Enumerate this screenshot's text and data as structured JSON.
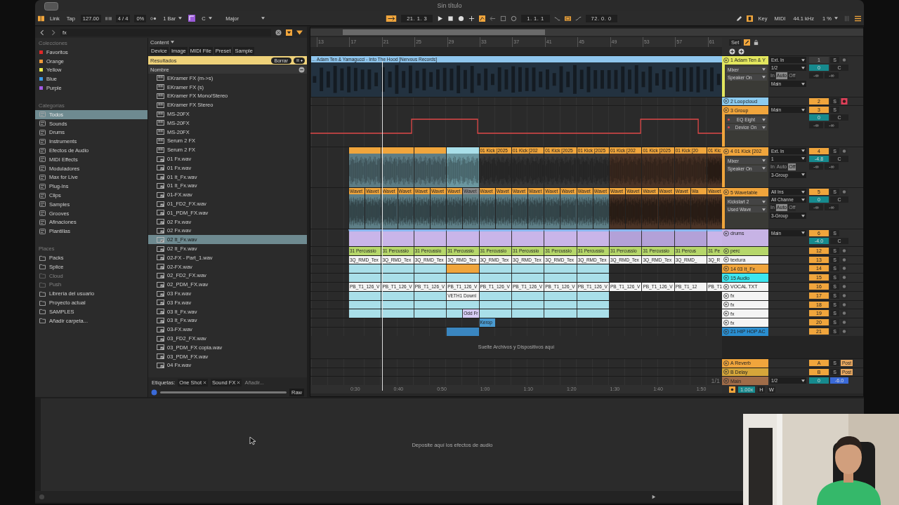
{
  "window": {
    "title": "Sin título"
  },
  "toolbar": {
    "link": "Link",
    "tap": "Tap",
    "tempo": "127.00",
    "signature": "4 / 4",
    "swing": "0%",
    "quantize": "1 Bar",
    "key": "C",
    "scale": "Major",
    "position": "21. 1. 3",
    "loop_start": "1. 1. 1",
    "loop_length": "72. 0. 0",
    "key_map": "Key",
    "midi_map": "MIDI",
    "sample_rate": "44.1 kHz",
    "cpu": "1 %"
  },
  "browser": {
    "search": "fx",
    "collections_title": "Colecciones",
    "collections": [
      {
        "label": "Favoritos",
        "color": "#e02828"
      },
      {
        "label": "Orange",
        "color": "#f09a3a"
      },
      {
        "label": "Yellow",
        "color": "#e8e84a"
      },
      {
        "label": "Blue",
        "color": "#3a9ae8"
      },
      {
        "label": "Purple",
        "color": "#a45ae8"
      }
    ],
    "categories_title": "Categorías",
    "categories": [
      {
        "label": "Todos",
        "selected": true
      },
      {
        "label": "Sounds",
        "selected": false
      },
      {
        "label": "Drums",
        "selected": false
      },
      {
        "label": "Instruments",
        "selected": false
      },
      {
        "label": "Efectos de Audio",
        "selected": false
      },
      {
        "label": "MIDI Effects",
        "selected": false
      },
      {
        "label": "Moduladores",
        "selected": false
      },
      {
        "label": "Max for Live",
        "selected": false
      },
      {
        "label": "Plug-Ins",
        "selected": false
      },
      {
        "label": "Clips",
        "selected": false
      },
      {
        "label": "Samples",
        "selected": false
      },
      {
        "label": "Grooves",
        "selected": false
      },
      {
        "label": "Afinaciones",
        "selected": false
      },
      {
        "label": "Plantillas",
        "selected": false
      }
    ],
    "places_title": "Places",
    "places": [
      {
        "label": "Packs",
        "disabled": false
      },
      {
        "label": "Splice",
        "disabled": false
      },
      {
        "label": "Cloud",
        "disabled": true
      },
      {
        "label": "Push",
        "disabled": true
      },
      {
        "label": "Librería del usuario",
        "disabled": false
      },
      {
        "label": "Proyecto actual",
        "disabled": false
      },
      {
        "label": "SAMPLES",
        "disabled": false
      },
      {
        "label": "Añadir carpeta...",
        "disabled": false
      }
    ],
    "content_filter": "Content",
    "filters": [
      "Device",
      "Image",
      "MIDI File",
      "Preset",
      "Sample"
    ],
    "results_label": "Resultados",
    "clear_button": "Borrar",
    "column": "Nombre",
    "files": [
      {
        "name": "EKramer FX (m->s)",
        "kind": "device",
        "selected": false
      },
      {
        "name": "EKramer FX (s)",
        "kind": "device",
        "selected": false
      },
      {
        "name": "EKramer FX Mono/Stereo",
        "kind": "device",
        "selected": false
      },
      {
        "name": "EKramer FX Stereo",
        "kind": "device",
        "selected": false
      },
      {
        "name": "MS-20FX",
        "kind": "device",
        "selected": false
      },
      {
        "name": "MS-20FX",
        "kind": "device",
        "selected": false
      },
      {
        "name": "MS-20FX",
        "kind": "device",
        "selected": false
      },
      {
        "name": "Serum 2 FX",
        "kind": "device",
        "selected": false
      },
      {
        "name": "Serum 2 FX",
        "kind": "device",
        "selected": false
      },
      {
        "name": "01 Fx.wav",
        "kind": "sample",
        "selected": false
      },
      {
        "name": "01 Fx.wav",
        "kind": "sample",
        "selected": false
      },
      {
        "name": "01 It_Fx.wav",
        "kind": "sample",
        "selected": false
      },
      {
        "name": "01 It_Fx.wav",
        "kind": "sample",
        "selected": false
      },
      {
        "name": "01-FX.wav",
        "kind": "sample",
        "selected": false
      },
      {
        "name": "01_FD2_FX.wav",
        "kind": "sample",
        "selected": false
      },
      {
        "name": "01_PDM_FX.wav",
        "kind": "sample",
        "selected": false
      },
      {
        "name": "02 Fx.wav",
        "kind": "sample",
        "selected": false
      },
      {
        "name": "02 Fx.wav",
        "kind": "sample",
        "selected": false
      },
      {
        "name": "02 It_Fx.wav",
        "kind": "sample",
        "selected": true
      },
      {
        "name": "02 It_Fx.wav",
        "kind": "sample",
        "selected": false
      },
      {
        "name": "02-FX - Part_1.wav",
        "kind": "sample",
        "selected": false
      },
      {
        "name": "02-FX.wav",
        "kind": "sample",
        "selected": false
      },
      {
        "name": "02_FD2_FX.wav",
        "kind": "sample",
        "selected": false
      },
      {
        "name": "02_PDM_FX.wav",
        "kind": "sample",
        "selected": false
      },
      {
        "name": "03 Fx.wav",
        "kind": "sample",
        "selected": false
      },
      {
        "name": "03 Fx.wav",
        "kind": "sample",
        "selected": false
      },
      {
        "name": "03 It_Fx.wav",
        "kind": "sample",
        "selected": false
      },
      {
        "name": "03 It_Fx.wav",
        "kind": "sample",
        "selected": false
      },
      {
        "name": "03-FX.wav",
        "kind": "sample",
        "selected": false
      },
      {
        "name": "03_FD2_FX.wav",
        "kind": "sample",
        "selected": false
      },
      {
        "name": "03_PDM_FX copia.wav",
        "kind": "sample",
        "selected": false
      },
      {
        "name": "03_PDM_FX.wav",
        "kind": "sample",
        "selected": false
      },
      {
        "name": "04 Fx.wav",
        "kind": "sample",
        "selected": false
      }
    ],
    "tags_label": "Etiquetas:",
    "tags": [
      "One Shot",
      "Sound FX"
    ],
    "tag_placeholder": "Añadir...",
    "raw_button": "Raw"
  },
  "arrangement": {
    "bars": [
      "13",
      "17",
      "21",
      "25",
      "29",
      "33",
      "37",
      "41",
      "45",
      "49",
      "53",
      "57",
      "61"
    ],
    "times": [
      "0:30",
      "0:40",
      "0:50",
      "1:00",
      "1:10",
      "1:20",
      "1:30",
      "1:40",
      "1:50"
    ],
    "set_label": "Set",
    "drop_hint": "Suelte Archivos y Dispositivos aquí",
    "zoom_ratio": "1/1",
    "tracks": [
      {
        "name": "1 Adam Ten & Y",
        "kind": "tall",
        "color": "#e2e65e",
        "devices": [
          {
            "label": "Mixer",
            "automated": false
          },
          {
            "label": "Speaker On",
            "automated": false
          }
        ],
        "inputs": [
          "Ext. In",
          "1/2"
        ],
        "monitor": [
          {
            "label": "In",
            "selected": false
          },
          {
            "label": "Auto",
            "selected": true
          },
          {
            "label": "Off",
            "selected": false
          }
        ],
        "output": "Main",
        "number": "1",
        "on": false,
        "solo": "S",
        "armed": false,
        "volume": "0",
        "pan": "C",
        "sends": [
          "-∞",
          "-∞"
        ],
        "clips": [
          {
            "kind": "full",
            "label": "... Adam Ten & Yamagucci - Into The Hood [Nervous Records]",
            "color": "#8fc6ee",
            "body": {
              "color": "#233240"
            }
          }
        ]
      },
      {
        "name": "2 Loopcloud",
        "kind": "short",
        "color": "#8ccbef",
        "number": "2",
        "on": true,
        "solo": "S",
        "armed": true
      },
      {
        "name": "3 Group",
        "kind": "tall",
        "color": "#f0a53c",
        "devices": [
          {
            "label": "EQ Eight",
            "automated": true
          },
          {
            "label": "Device On",
            "automated": true
          }
        ],
        "output": "Main",
        "number": "3",
        "on": true,
        "solo": "S",
        "volume": "0",
        "pan": "C",
        "sends": [
          "-∞",
          "-∞"
        ],
        "clips": [
          {
            "kind": "automation"
          }
        ]
      },
      {
        "name": "4 01 Kick [202",
        "kind": "tall",
        "color": "#f0a53c",
        "devices": [
          {
            "label": "Mixer",
            "automated": false
          },
          {
            "label": "Speaker On",
            "automated": false
          }
        ],
        "inputs": [
          "Ext. In",
          "1"
        ],
        "monitor": [
          {
            "label": "In",
            "selected": false
          },
          {
            "label": "Auto",
            "selected": false
          },
          {
            "label": "Off",
            "selected": true
          }
        ],
        "output": "3-Group",
        "number": "4",
        "on": true,
        "solo": "S",
        "armed": false,
        "volume": "-4.8",
        "pan": "C",
        "sends": [
          "-∞",
          "-∞"
        ],
        "clips": [
          {
            "kind": "clip",
            "color": "#f0a53c",
            "body": {
              "color": "#5d7c84"
            }
          },
          {
            "kind": "clip",
            "color": "#f0a53c",
            "body": {
              "color": "#5d7c84"
            }
          },
          {
            "kind": "clip",
            "color": "#f0a53c",
            "body": {
              "color": "#5d7c84"
            }
          },
          {
            "kind": "clip",
            "color": "#a9dfe9",
            "body": {
              "color": "#6b97a0"
            }
          },
          {
            "kind": "clip",
            "label": "01 Kick [2025",
            "color": "#f0a53c",
            "body": {
              "color": "#363636"
            }
          },
          {
            "kind": "clip",
            "label": "01 Kick [202",
            "color": "#f0a53c",
            "body": {
              "color": "#363636"
            }
          },
          {
            "kind": "clip",
            "label": "01 Kick [2025",
            "color": "#f0a53c",
            "body": {
              "color": "#363636"
            }
          },
          {
            "kind": "clip",
            "label": "01 Kick [2025",
            "color": "#f0a53c",
            "body": {
              "color": "#363636"
            }
          },
          {
            "kind": "clip",
            "label": "01 Kick [202",
            "color": "#f0a53c",
            "body": {
              "color": "#4a3326"
            }
          },
          {
            "kind": "clip",
            "label": "01 Kick [2025",
            "color": "#f0a53c",
            "body": {
              "color": "#4a3326"
            }
          },
          {
            "kind": "clip",
            "label": "01 Kick [20",
            "color": "#f0a53c",
            "body": {
              "color": "#4a3326"
            }
          },
          {
            "kind": "end",
            "label": "01 Kic",
            "color": "#f0a53c",
            "body": {
              "color": "#4a3326"
            }
          }
        ]
      },
      {
        "name": "5 Wavetable",
        "kind": "tall",
        "color": "#f0a53c",
        "devices": [
          {
            "label": "Kickstart 2",
            "automated": false
          },
          {
            "label": "Used Wave",
            "automated": false
          }
        ],
        "inputs": [
          "All Ins",
          "All Channe"
        ],
        "monitor": [
          {
            "label": "In",
            "selected": false
          },
          {
            "label": "Auto",
            "selected": true
          },
          {
            "label": "Off",
            "selected": false
          }
        ],
        "output": "3-Group",
        "number": "5",
        "on": true,
        "solo": "S",
        "armed": false,
        "volume": "0",
        "pan": "C",
        "sends": [
          "-∞",
          "-∞"
        ],
        "clips": [
          {
            "kind": "half",
            "label": "Wavet",
            "color": "#f0a53c",
            "body": {
              "color": "#5e7f87"
            }
          },
          {
            "kind": "half",
            "label": "Wavet",
            "color": "#f0a53c",
            "body": {
              "color": "#5e7f87"
            }
          },
          {
            "kind": "half",
            "label": "Wavet",
            "color": "#f0a53c",
            "body": {
              "color": "#5e7f87"
            }
          },
          {
            "kind": "half",
            "label": "Wavet",
            "color": "#f0a53c",
            "body": {
              "color": "#5e7f87"
            }
          },
          {
            "kind": "half",
            "label": "Wavet",
            "color": "#f0a53c",
            "body": {
              "color": "#5e7f87"
            }
          },
          {
            "kind": "half",
            "label": "Wavet",
            "color": "#f0a53c",
            "body": {
              "color": "#5e7f87"
            }
          },
          {
            "kind": "half",
            "label": "Wavet",
            "color": "#f0a53c",
            "body": {
              "color": "#5e7f87"
            }
          },
          {
            "kind": "half",
            "label": "Wavet",
            "color": "#8c8c8c",
            "body": {
              "color": "#5e7f87"
            }
          },
          {
            "kind": "half",
            "label": "Wavet",
            "color": "#f0a53c",
            "body": {
              "color": "#5e7f87"
            }
          },
          {
            "kind": "half",
            "label": "Wavet",
            "color": "#f0a53c",
            "body": {
              "color": "#5e7f87"
            }
          },
          {
            "kind": "half",
            "label": "Wavet",
            "color": "#f0a53c",
            "body": {
              "color": "#5e7f87"
            }
          },
          {
            "kind": "half",
            "label": "Wavet",
            "color": "#f0a53c",
            "body": {
              "color": "#5e7f87"
            }
          },
          {
            "kind": "half",
            "label": "Wavet",
            "color": "#f0a53c",
            "body": {
              "color": "#5e7f87"
            }
          },
          {
            "kind": "half",
            "label": "Wavet",
            "color": "#f0a53c",
            "body": {
              "color": "#5e7f87"
            }
          },
          {
            "kind": "half",
            "label": "Wavet",
            "color": "#f0a53c",
            "body": {
              "color": "#5e7f87"
            }
          },
          {
            "kind": "half",
            "label": "Wavet",
            "color": "#f0a53c",
            "body": {
              "color": "#5e7f87"
            }
          },
          {
            "kind": "half",
            "label": "Wavet",
            "color": "#f0a53c",
            "body": {
              "color": "#4a3326"
            }
          },
          {
            "kind": "half",
            "label": "Wavet",
            "color": "#f0a53c",
            "body": {
              "color": "#4a3326"
            }
          },
          {
            "kind": "half",
            "label": "Wavet",
            "color": "#f0a53c",
            "body": {
              "color": "#4a3326"
            }
          },
          {
            "kind": "half",
            "label": "Wavet",
            "color": "#f0a53c",
            "body": {
              "color": "#4a3326"
            }
          },
          {
            "kind": "half",
            "label": "Wavet",
            "color": "#f0a53c",
            "body": {
              "color": "#4a3326"
            }
          },
          {
            "kind": "half",
            "label": "Wa",
            "color": "#f0a53c",
            "body": {
              "color": "#4a3326"
            }
          },
          {
            "kind": "end",
            "label": "Wavet",
            "color": "#f0a53c",
            "body": {
              "color": "#4a3326"
            }
          }
        ]
      },
      {
        "name": "drums",
        "kind": "medium",
        "color": "#c7b3e5",
        "output": "Main",
        "number": "6",
        "on": true,
        "solo": "S",
        "volume": "-4.0",
        "pan": "C",
        "clips": [
          {
            "kind": "clip",
            "color": "#c9b5e9"
          },
          {
            "kind": "clip",
            "color": "#c9b5e9"
          },
          {
            "kind": "clip",
            "color": "#c9b5e9"
          },
          {
            "kind": "clip",
            "color": "#c9b5e9"
          },
          {
            "kind": "clip",
            "color": "#c9b5e9"
          },
          {
            "kind": "clip",
            "color": "#c9b5e9"
          },
          {
            "kind": "clip",
            "color": "#c9b5e9"
          },
          {
            "kind": "clip",
            "color": "#c9b5e9"
          },
          {
            "kind": "clip",
            "color": "#b3a1d8"
          },
          {
            "kind": "clip",
            "color": "#b3a1d8"
          },
          {
            "kind": "clip",
            "color": "#b3a1d8"
          },
          {
            "kind": "end",
            "color": "#c9b5e9"
          }
        ]
      },
      {
        "name": "perc",
        "kind": "short",
        "color": "#b6d76a",
        "number": "12",
        "on": true,
        "solo": "S",
        "armed": false,
        "clips": [
          {
            "kind": "clip",
            "label": "31 Percussio",
            "color": "#b6d76a"
          },
          {
            "kind": "clip",
            "label": "31 Percussio",
            "color": "#b6d76a"
          },
          {
            "kind": "clip",
            "label": "31 Percussio",
            "color": "#b6d76a"
          },
          {
            "kind": "clip",
            "label": "31 Percussio",
            "color": "#b6d76a"
          },
          {
            "kind": "clip",
            "label": "31 Percussio",
            "color": "#b6d76a"
          },
          {
            "kind": "clip",
            "label": "31 Percussio",
            "color": "#b6d76a"
          },
          {
            "kind": "clip",
            "label": "31 Percussio",
            "color": "#b6d76a"
          },
          {
            "kind": "clip",
            "label": "31 Percussio",
            "color": "#b6d76a"
          },
          {
            "kind": "clip",
            "label": "31 Percussio",
            "color": "#b6d76a"
          },
          {
            "kind": "clip",
            "label": "31 Percussio",
            "color": "#b6d76a"
          },
          {
            "kind": "clip",
            "label": "31 Percus",
            "color": "#b6d76a"
          },
          {
            "kind": "end",
            "label": "31 Pe",
            "color": "#b6d76a"
          }
        ]
      },
      {
        "name": "textura",
        "kind": "short",
        "color": "#f4f4f4",
        "number": "13",
        "on": true,
        "solo": "S",
        "armed": false,
        "clips": [
          {
            "kind": "clip",
            "label": "3Q_RMD_Tex",
            "color": "#f4f4f4"
          },
          {
            "kind": "clip",
            "label": "3Q_RMD_Tex",
            "color": "#f4f4f4"
          },
          {
            "kind": "clip",
            "label": "3Q_RMD_Tex",
            "color": "#f4f4f4"
          },
          {
            "kind": "clip",
            "label": "3Q_RMD_Tex",
            "color": "#f4f4f4"
          },
          {
            "kind": "clip",
            "label": "3Q_RMD_Tex",
            "color": "#f4f4f4"
          },
          {
            "kind": "clip",
            "label": "3Q_RMD_Tex",
            "color": "#f4f4f4"
          },
          {
            "kind": "clip",
            "label": "3Q_RMD_Tex",
            "color": "#f4f4f4"
          },
          {
            "kind": "clip",
            "label": "3Q_RMD_Tex",
            "color": "#f4f4f4"
          },
          {
            "kind": "clip",
            "label": "3Q_RMD_Tex",
            "color": "#f4f4f4"
          },
          {
            "kind": "clip",
            "label": "3Q_RMD_Tex",
            "color": "#f4f4f4"
          },
          {
            "kind": "clip",
            "label": "3Q_RMD_",
            "color": "#f4f4f4"
          },
          {
            "kind": "end",
            "label": "3Q_R",
            "color": "#f4f4f4"
          }
        ]
      },
      {
        "name": "14 03 It_Fx",
        "kind": "short",
        "color": "#f0a53c",
        "number": "14",
        "on": true,
        "solo": "S",
        "armed": false,
        "clips": [
          {
            "kind": "clip",
            "color": "#a9dfe9"
          },
          {
            "kind": "clip",
            "color": "#a9dfe9"
          },
          {
            "kind": "clip",
            "color": "#a9dfe9"
          },
          {
            "kind": "clip",
            "color": "#f0a53c"
          },
          {
            "kind": "clip",
            "color": "#a9dfe9"
          },
          {
            "kind": "clip",
            "color": "#a9dfe9"
          },
          {
            "kind": "clip",
            "color": "#a9dfe9"
          },
          {
            "kind": "clip",
            "color": "#a9dfe9"
          }
        ]
      },
      {
        "name": "15 Audio",
        "kind": "short",
        "color": "#3de6ef",
        "number": "15",
        "on": true,
        "solo": "S",
        "armed": false,
        "clips": [
          {
            "kind": "clip",
            "color": "#a9dfe9"
          },
          {
            "kind": "clip",
            "color": "#a9dfe9"
          },
          {
            "kind": "clip",
            "color": "#a9dfe9"
          },
          {
            "kind": "clip",
            "color": "#a9dfe9"
          },
          {
            "kind": "clip",
            "color": "#a9dfe9"
          },
          {
            "kind": "clip",
            "color": "#a9dfe9"
          },
          {
            "kind": "clip",
            "color": "#a9dfe9"
          },
          {
            "kind": "clip",
            "color": "#a9dfe9"
          }
        ]
      },
      {
        "name": "VOCAL TXT",
        "kind": "short",
        "color": "#f4f4f4",
        "number": "16",
        "on": true,
        "solo": "S",
        "armed": false,
        "clips": [
          {
            "kind": "clip",
            "label": "PB_T1_126_V",
            "color": "#f4f4f4"
          },
          {
            "kind": "clip",
            "label": "PB_T1_126_V",
            "color": "#f4f4f4"
          },
          {
            "kind": "clip",
            "label": "PB_T1_126_V",
            "color": "#f4f4f4"
          },
          {
            "kind": "clip",
            "label": "PB_T1_126_V",
            "color": "#f4f4f4"
          },
          {
            "kind": "clip",
            "label": "PB_T1_126_V",
            "color": "#f4f4f4"
          },
          {
            "kind": "clip",
            "label": "PB_T1_126_V",
            "color": "#f4f4f4"
          },
          {
            "kind": "clip",
            "label": "PB_T1_126_V",
            "color": "#f4f4f4"
          },
          {
            "kind": "clip",
            "label": "PB_T1_126_V",
            "color": "#f4f4f4"
          },
          {
            "kind": "clip",
            "label": "PB_T1_126_V",
            "color": "#f4f4f4"
          },
          {
            "kind": "clip",
            "label": "PB_T1_126_V",
            "color": "#f4f4f4"
          },
          {
            "kind": "clip",
            "label": "PB_T1_12",
            "color": "#f4f4f4"
          },
          {
            "kind": "end",
            "label": "PB_T1",
            "color": "#f4f4f4"
          }
        ]
      },
      {
        "name": "fx",
        "kind": "short",
        "color": "#f4f4f4",
        "number": "17",
        "on": true,
        "solo": "S",
        "armed": false,
        "clips": [
          {
            "kind": "clip",
            "color": "#a9dfe9"
          },
          {
            "kind": "clip",
            "color": "#a9dfe9"
          },
          {
            "kind": "clip",
            "color": "#a9dfe9"
          },
          {
            "kind": "clip",
            "label": "VETH1 Downl",
            "color": "#f4f4f4"
          },
          {
            "kind": "clip",
            "color": "#a9dfe9"
          },
          {
            "kind": "clip",
            "color": "#a9dfe9"
          },
          {
            "kind": "clip",
            "color": "#a9dfe9"
          },
          {
            "kind": "clip",
            "color": "#a9dfe9"
          }
        ]
      },
      {
        "name": "fx",
        "kind": "short",
        "color": "#f4f4f4",
        "number": "18",
        "on": true,
        "solo": "S",
        "armed": false,
        "clips": [
          {
            "kind": "clip",
            "color": "#a9dfe9"
          },
          {
            "kind": "clip",
            "color": "#a9dfe9"
          },
          {
            "kind": "clip",
            "color": "#a9dfe9"
          },
          {
            "kind": "clip",
            "color": "#a9dfe9"
          },
          {
            "kind": "clip",
            "color": "#a9dfe9"
          },
          {
            "kind": "clip",
            "color": "#a9dfe9"
          },
          {
            "kind": "clip",
            "color": "#a9dfe9"
          },
          {
            "kind": "clip",
            "color": "#a9dfe9"
          }
        ]
      },
      {
        "name": "fx",
        "kind": "short",
        "color": "#f4f4f4",
        "number": "19",
        "on": true,
        "solo": "S",
        "armed": false,
        "clips": [
          {
            "kind": "clip",
            "color": "#a9dfe9"
          },
          {
            "kind": "clip",
            "color": "#a9dfe9"
          },
          {
            "kind": "clip",
            "color": "#a9dfe9"
          },
          {
            "kind": "half",
            "color": "#a9dfe9"
          },
          {
            "kind": "half",
            "label": "Odd Fr",
            "color": "#d6ccf4"
          },
          {
            "kind": "clip",
            "color": "#a9dfe9"
          },
          {
            "kind": "clip",
            "color": "#a9dfe9"
          },
          {
            "kind": "clip",
            "color": "#a9dfe9"
          },
          {
            "kind": "clip",
            "color": "#a9dfe9"
          }
        ]
      },
      {
        "name": "fx",
        "kind": "short",
        "color": "#f4f4f4",
        "number": "20",
        "on": true,
        "solo": "S",
        "armed": false,
        "clips": [
          {
            "kind": "gap"
          },
          {
            "kind": "gap"
          },
          {
            "kind": "gap"
          },
          {
            "kind": "gap"
          },
          {
            "kind": "half",
            "label": "Kerop",
            "color": "#4a9ad0"
          }
        ]
      },
      {
        "name": "21 HIP HOP AC",
        "kind": "short",
        "color": "#2a8ed0",
        "number": "21",
        "on": true,
        "solo": "S",
        "armed": false,
        "clips": [
          {
            "kind": "gap"
          },
          {
            "kind": "gap"
          },
          {
            "kind": "gap"
          },
          {
            "kind": "clip",
            "color": "#3a86c0"
          }
        ]
      }
    ],
    "returns": [
      {
        "name": "A Reverb",
        "kind": "return",
        "color": "#f0a53c",
        "number": "A",
        "on": true,
        "solo": "S",
        "post": "Post"
      },
      {
        "name": "B Delay",
        "kind": "return",
        "color": "#d6a63a",
        "number": "B",
        "on": true,
        "solo": "S",
        "post": "Post"
      },
      {
        "name": "Main",
        "kind": "main",
        "color": "#a06c48",
        "output": "1/2",
        "volume": "0",
        "pan": "-6.0"
      }
    ],
    "tempo_scale": "1.00x",
    "h_button": "H",
    "w_button": "W"
  },
  "devices": {
    "drop_hint": "Deposite aquí los efectos de audio"
  }
}
